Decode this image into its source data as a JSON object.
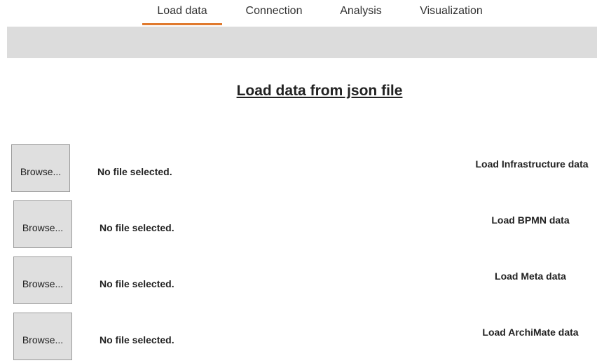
{
  "nav": {
    "tabs": [
      {
        "label": "Load data",
        "active": true
      },
      {
        "label": "Connection",
        "active": false
      },
      {
        "label": "Analysis",
        "active": false
      },
      {
        "label": "Visualization",
        "active": false
      }
    ]
  },
  "page": {
    "title": "Load data from json file"
  },
  "rows": [
    {
      "browse_label": "Browse...",
      "file_status": "No file selected.",
      "load_label": "Load Infrastructure data"
    },
    {
      "browse_label": "Browse...",
      "file_status": "No file selected.",
      "load_label": "Load BPMN data"
    },
    {
      "browse_label": "Browse...",
      "file_status": "No file selected.",
      "load_label": "Load Meta data"
    },
    {
      "browse_label": "Browse...",
      "file_status": "No file selected.",
      "load_label": "Load ArchiMate data"
    }
  ],
  "colors": {
    "accent": "#e07a2e",
    "toolbar_bg": "#dcdcdc",
    "button_bg": "#dfdfdf"
  }
}
